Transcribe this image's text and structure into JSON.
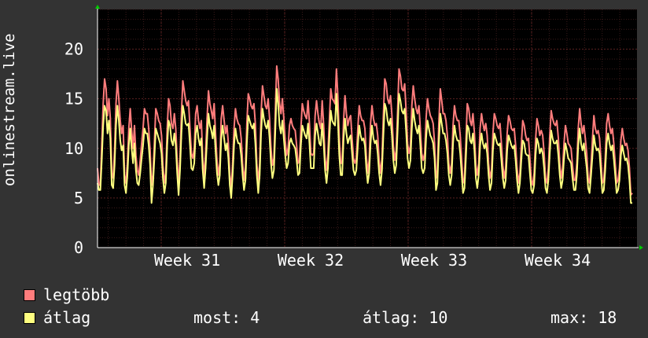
{
  "chart_data": {
    "type": "line",
    "ylabel": "onlinestream.live",
    "ylim": [
      0,
      24
    ],
    "yticks": [
      0,
      5,
      10,
      15,
      20
    ],
    "x_tick_labels": [
      "Week 31",
      "Week 32",
      "Week 33",
      "Week 34"
    ],
    "grid": true,
    "legend_placement": "bottom-left",
    "series": [
      {
        "name": "legtöbb",
        "color": "#ff7d7d",
        "values": [
          8.0,
          6.3,
          6.3,
          10.5,
          14.5,
          17.0,
          16.0,
          13.3,
          15.0,
          13.0,
          7.5,
          7.0,
          9.8,
          14.5,
          16.8,
          15.0,
          12.8,
          11.5,
          12.3,
          7.3,
          6.5,
          8.5,
          12.0,
          14.0,
          11.8,
          10.0,
          12.3,
          9.3,
          7.8,
          7.3,
          8.8,
          10.5,
          12.0,
          14.0,
          13.5,
          13.5,
          12.0,
          9.8,
          6.3,
          7.3,
          10.5,
          14.0,
          13.5,
          12.8,
          12.5,
          11.3,
          8.3,
          6.5,
          7.5,
          12.0,
          15.0,
          14.3,
          12.5,
          12.0,
          13.5,
          12.0,
          8.8,
          6.3,
          9.0,
          13.5,
          16.8,
          15.8,
          14.8,
          14.3,
          14.8,
          12.0,
          9.5,
          9.0,
          10.0,
          13.5,
          14.3,
          12.8,
          12.0,
          12.8,
          9.0,
          7.0,
          9.5,
          13.0,
          15.8,
          14.5,
          13.8,
          13.0,
          14.5,
          11.5,
          8.8,
          7.3,
          8.5,
          13.0,
          14.3,
          12.8,
          11.5,
          12.3,
          10.5,
          7.3,
          6.0,
          8.5,
          12.0,
          14.0,
          13.0,
          12.5,
          12.3,
          11.0,
          8.5,
          6.8,
          8.0,
          12.5,
          15.5,
          15.0,
          14.3,
          14.0,
          14.5,
          12.5,
          8.5,
          6.5,
          8.5,
          13.5,
          16.3,
          15.3,
          14.3,
          14.0,
          15.0,
          13.0,
          10.0,
          8.3,
          9.0,
          13.8,
          18.3,
          17.0,
          14.5,
          13.5,
          15.0,
          13.0,
          10.8,
          9.3,
          10.0,
          12.3,
          13.0,
          12.3,
          12.0,
          11.8,
          10.3,
          8.5,
          8.8,
          12.0,
          14.5,
          13.8,
          13.3,
          13.0,
          14.8,
          12.5,
          9.5,
          9.3,
          9.5,
          13.3,
          14.8,
          13.5,
          12.5,
          12.0,
          14.8,
          12.3,
          9.0,
          7.8,
          9.5,
          12.8,
          16.0,
          15.0,
          14.8,
          14.5,
          18.0,
          15.3,
          11.0,
          8.5,
          8.5,
          12.8,
          15.3,
          13.5,
          12.3,
          13.0,
          13.3,
          11.0,
          9.0,
          8.5,
          9.0,
          12.0,
          14.3,
          13.3,
          12.8,
          12.8,
          12.0,
          9.3,
          7.5,
          8.8,
          12.5,
          14.3,
          13.0,
          12.3,
          12.5,
          11.3,
          8.8,
          7.5,
          9.0,
          13.3,
          17.0,
          16.5,
          15.0,
          14.5,
          15.3,
          13.3,
          10.3,
          8.8,
          9.8,
          13.8,
          18.0,
          17.3,
          16.0,
          15.8,
          16.5,
          13.8,
          10.5,
          9.5,
          10.3,
          14.3,
          16.3,
          15.0,
          14.0,
          13.5,
          14.3,
          12.0,
          9.5,
          8.8,
          9.5,
          13.0,
          15.0,
          14.0,
          13.3,
          13.0,
          12.5,
          10.5,
          7.0,
          7.8,
          12.5,
          16.0,
          14.8,
          13.5,
          13.5,
          12.8,
          11.3,
          8.5,
          7.5,
          8.5,
          12.3,
          14.3,
          13.3,
          12.8,
          12.8,
          11.3,
          9.0,
          6.5,
          7.0,
          10.5,
          14.5,
          14.0,
          12.8,
          12.3,
          13.5,
          11.5,
          8.3,
          7.3,
          8.5,
          12.0,
          13.5,
          12.5,
          11.8,
          12.5,
          11.3,
          8.5,
          7.0,
          7.8,
          11.5,
          13.5,
          13.0,
          12.3,
          12.0,
          12.5,
          10.5,
          8.3,
          7.0,
          8.0,
          11.5,
          13.3,
          12.8,
          12.0,
          11.8,
          12.0,
          10.3,
          8.0,
          6.5,
          7.5,
          10.3,
          12.8,
          12.3,
          11.3,
          10.8,
          11.0,
          9.0,
          6.8,
          6.3,
          7.5,
          10.8,
          13.0,
          12.3,
          11.3,
          11.8,
          11.3,
          9.5,
          7.0,
          6.5,
          8.0,
          11.3,
          13.8,
          13.0,
          12.5,
          12.3,
          12.8,
          11.0,
          8.5,
          7.0,
          8.0,
          10.5,
          12.3,
          11.5,
          10.5,
          10.3,
          10.0,
          8.3,
          6.8,
          6.8,
          8.5,
          12.0,
          14.0,
          12.5,
          11.5,
          12.3,
          11.0,
          9.5,
          7.0,
          6.5,
          8.5,
          11.0,
          13.3,
          12.0,
          11.5,
          11.8,
          11.0,
          8.8,
          6.5,
          6.8,
          9.0,
          12.5,
          13.5,
          12.3,
          11.5,
          12.0,
          10.5,
          8.5,
          6.5,
          6.8,
          8.0,
          10.8,
          12.0,
          11.0,
          10.3,
          10.5,
          9.8,
          8.0,
          5.3,
          5.5
        ],
        "data_stats": null
      },
      {
        "name": "átlag",
        "color": "#ffff80",
        "values": [
          6.5,
          5.8,
          5.8,
          8.8,
          12.3,
          14.3,
          13.8,
          11.5,
          12.8,
          11.0,
          6.3,
          6.0,
          8.3,
          12.3,
          14.3,
          12.8,
          10.8,
          9.8,
          10.3,
          6.3,
          5.5,
          7.3,
          10.3,
          12.0,
          10.0,
          8.5,
          10.5,
          7.8,
          6.5,
          6.3,
          7.5,
          9.0,
          10.3,
          12.0,
          11.5,
          11.5,
          10.3,
          8.3,
          4.5,
          6.3,
          9.0,
          12.0,
          11.5,
          11.0,
          10.5,
          9.5,
          7.0,
          5.5,
          6.5,
          10.3,
          12.8,
          12.3,
          10.8,
          10.3,
          11.5,
          10.3,
          7.5,
          5.3,
          7.8,
          11.5,
          14.3,
          13.5,
          12.5,
          12.3,
          12.5,
          10.3,
          8.0,
          7.8,
          8.5,
          11.5,
          12.3,
          11.0,
          10.3,
          11.0,
          7.8,
          6.0,
          8.0,
          11.0,
          13.5,
          12.3,
          11.8,
          11.0,
          12.3,
          9.8,
          7.5,
          6.3,
          7.3,
          11.0,
          12.3,
          11.0,
          9.8,
          10.5,
          9.0,
          6.3,
          5.0,
          7.3,
          10.3,
          12.0,
          11.0,
          10.5,
          10.5,
          9.3,
          7.3,
          5.8,
          6.8,
          10.5,
          13.3,
          12.8,
          12.3,
          12.0,
          12.5,
          10.5,
          7.3,
          5.5,
          7.3,
          11.5,
          14.0,
          13.0,
          12.3,
          12.0,
          12.8,
          11.0,
          8.5,
          7.0,
          7.8,
          11.8,
          16.0,
          14.5,
          12.3,
          11.5,
          12.8,
          11.0,
          9.3,
          8.0,
          8.5,
          10.5,
          11.0,
          10.5,
          10.3,
          10.0,
          8.8,
          7.3,
          7.5,
          10.3,
          12.3,
          11.8,
          11.3,
          11.0,
          12.5,
          10.5,
          8.0,
          8.0,
          8.0,
          11.3,
          12.5,
          11.5,
          10.5,
          10.3,
          12.5,
          10.5,
          7.8,
          6.5,
          8.0,
          11.0,
          13.8,
          12.8,
          12.5,
          12.3,
          15.5,
          13.0,
          9.3,
          7.3,
          7.3,
          11.0,
          13.0,
          11.5,
          10.5,
          11.0,
          11.3,
          9.5,
          7.8,
          7.3,
          7.8,
          10.3,
          12.3,
          11.3,
          10.8,
          11.0,
          10.3,
          8.0,
          6.5,
          7.5,
          10.5,
          12.3,
          11.0,
          10.5,
          10.8,
          9.5,
          7.5,
          6.3,
          7.8,
          11.3,
          14.5,
          14.0,
          12.8,
          12.3,
          13.0,
          11.3,
          8.8,
          7.5,
          8.3,
          11.8,
          15.5,
          14.8,
          13.8,
          13.5,
          14.0,
          11.8,
          9.0,
          8.0,
          8.8,
          12.0,
          14.0,
          12.8,
          12.0,
          11.5,
          12.3,
          10.3,
          8.0,
          7.5,
          8.0,
          11.0,
          12.8,
          12.0,
          11.3,
          11.0,
          10.5,
          9.0,
          5.8,
          6.5,
          10.5,
          13.5,
          12.5,
          11.5,
          11.5,
          10.8,
          9.5,
          7.3,
          6.3,
          7.3,
          10.5,
          12.3,
          11.3,
          10.8,
          10.8,
          9.5,
          7.5,
          5.5,
          6.0,
          9.0,
          12.3,
          12.0,
          10.8,
          10.5,
          11.5,
          9.8,
          7.0,
          6.0,
          7.3,
          10.3,
          11.5,
          10.5,
          10.0,
          10.5,
          9.5,
          7.3,
          5.8,
          6.5,
          9.8,
          11.5,
          11.0,
          10.5,
          10.3,
          10.5,
          8.8,
          7.0,
          6.0,
          6.8,
          9.8,
          11.3,
          10.8,
          10.3,
          10.0,
          10.3,
          8.8,
          6.8,
          5.5,
          6.5,
          8.8,
          10.8,
          10.5,
          9.5,
          9.3,
          9.3,
          7.5,
          5.8,
          5.5,
          6.3,
          9.3,
          11.0,
          10.5,
          9.5,
          10.0,
          9.5,
          8.0,
          6.0,
          5.5,
          6.8,
          9.5,
          11.8,
          11.0,
          10.5,
          10.5,
          10.8,
          9.3,
          7.3,
          6.0,
          6.8,
          9.0,
          10.5,
          9.8,
          9.0,
          8.8,
          8.5,
          7.0,
          5.8,
          5.8,
          7.3,
          10.3,
          12.0,
          10.5,
          9.8,
          10.5,
          9.3,
          8.0,
          6.0,
          5.5,
          7.3,
          9.3,
          11.3,
          10.3,
          9.8,
          10.0,
          9.5,
          7.5,
          5.5,
          5.8,
          7.8,
          10.5,
          11.5,
          10.5,
          9.8,
          10.3,
          9.0,
          7.3,
          5.5,
          5.8,
          6.8,
          9.3,
          10.3,
          9.5,
          8.8,
          9.0,
          8.3,
          6.8,
          4.5,
          4.5
        ]
      }
    ]
  },
  "legend": [
    {
      "label": "legtöbb",
      "color": "#ff7d7d"
    },
    {
      "label": "átlag",
      "color": "#ffff80"
    }
  ],
  "stats": {
    "most": "most: 4",
    "atlag": "átlag: 10",
    "max": "max: 18"
  },
  "colors": {
    "background": "#333333",
    "plot_background": "#000000",
    "grid": "#5a2020",
    "axis": "#ffffff",
    "arrow": "#00cc00"
  }
}
